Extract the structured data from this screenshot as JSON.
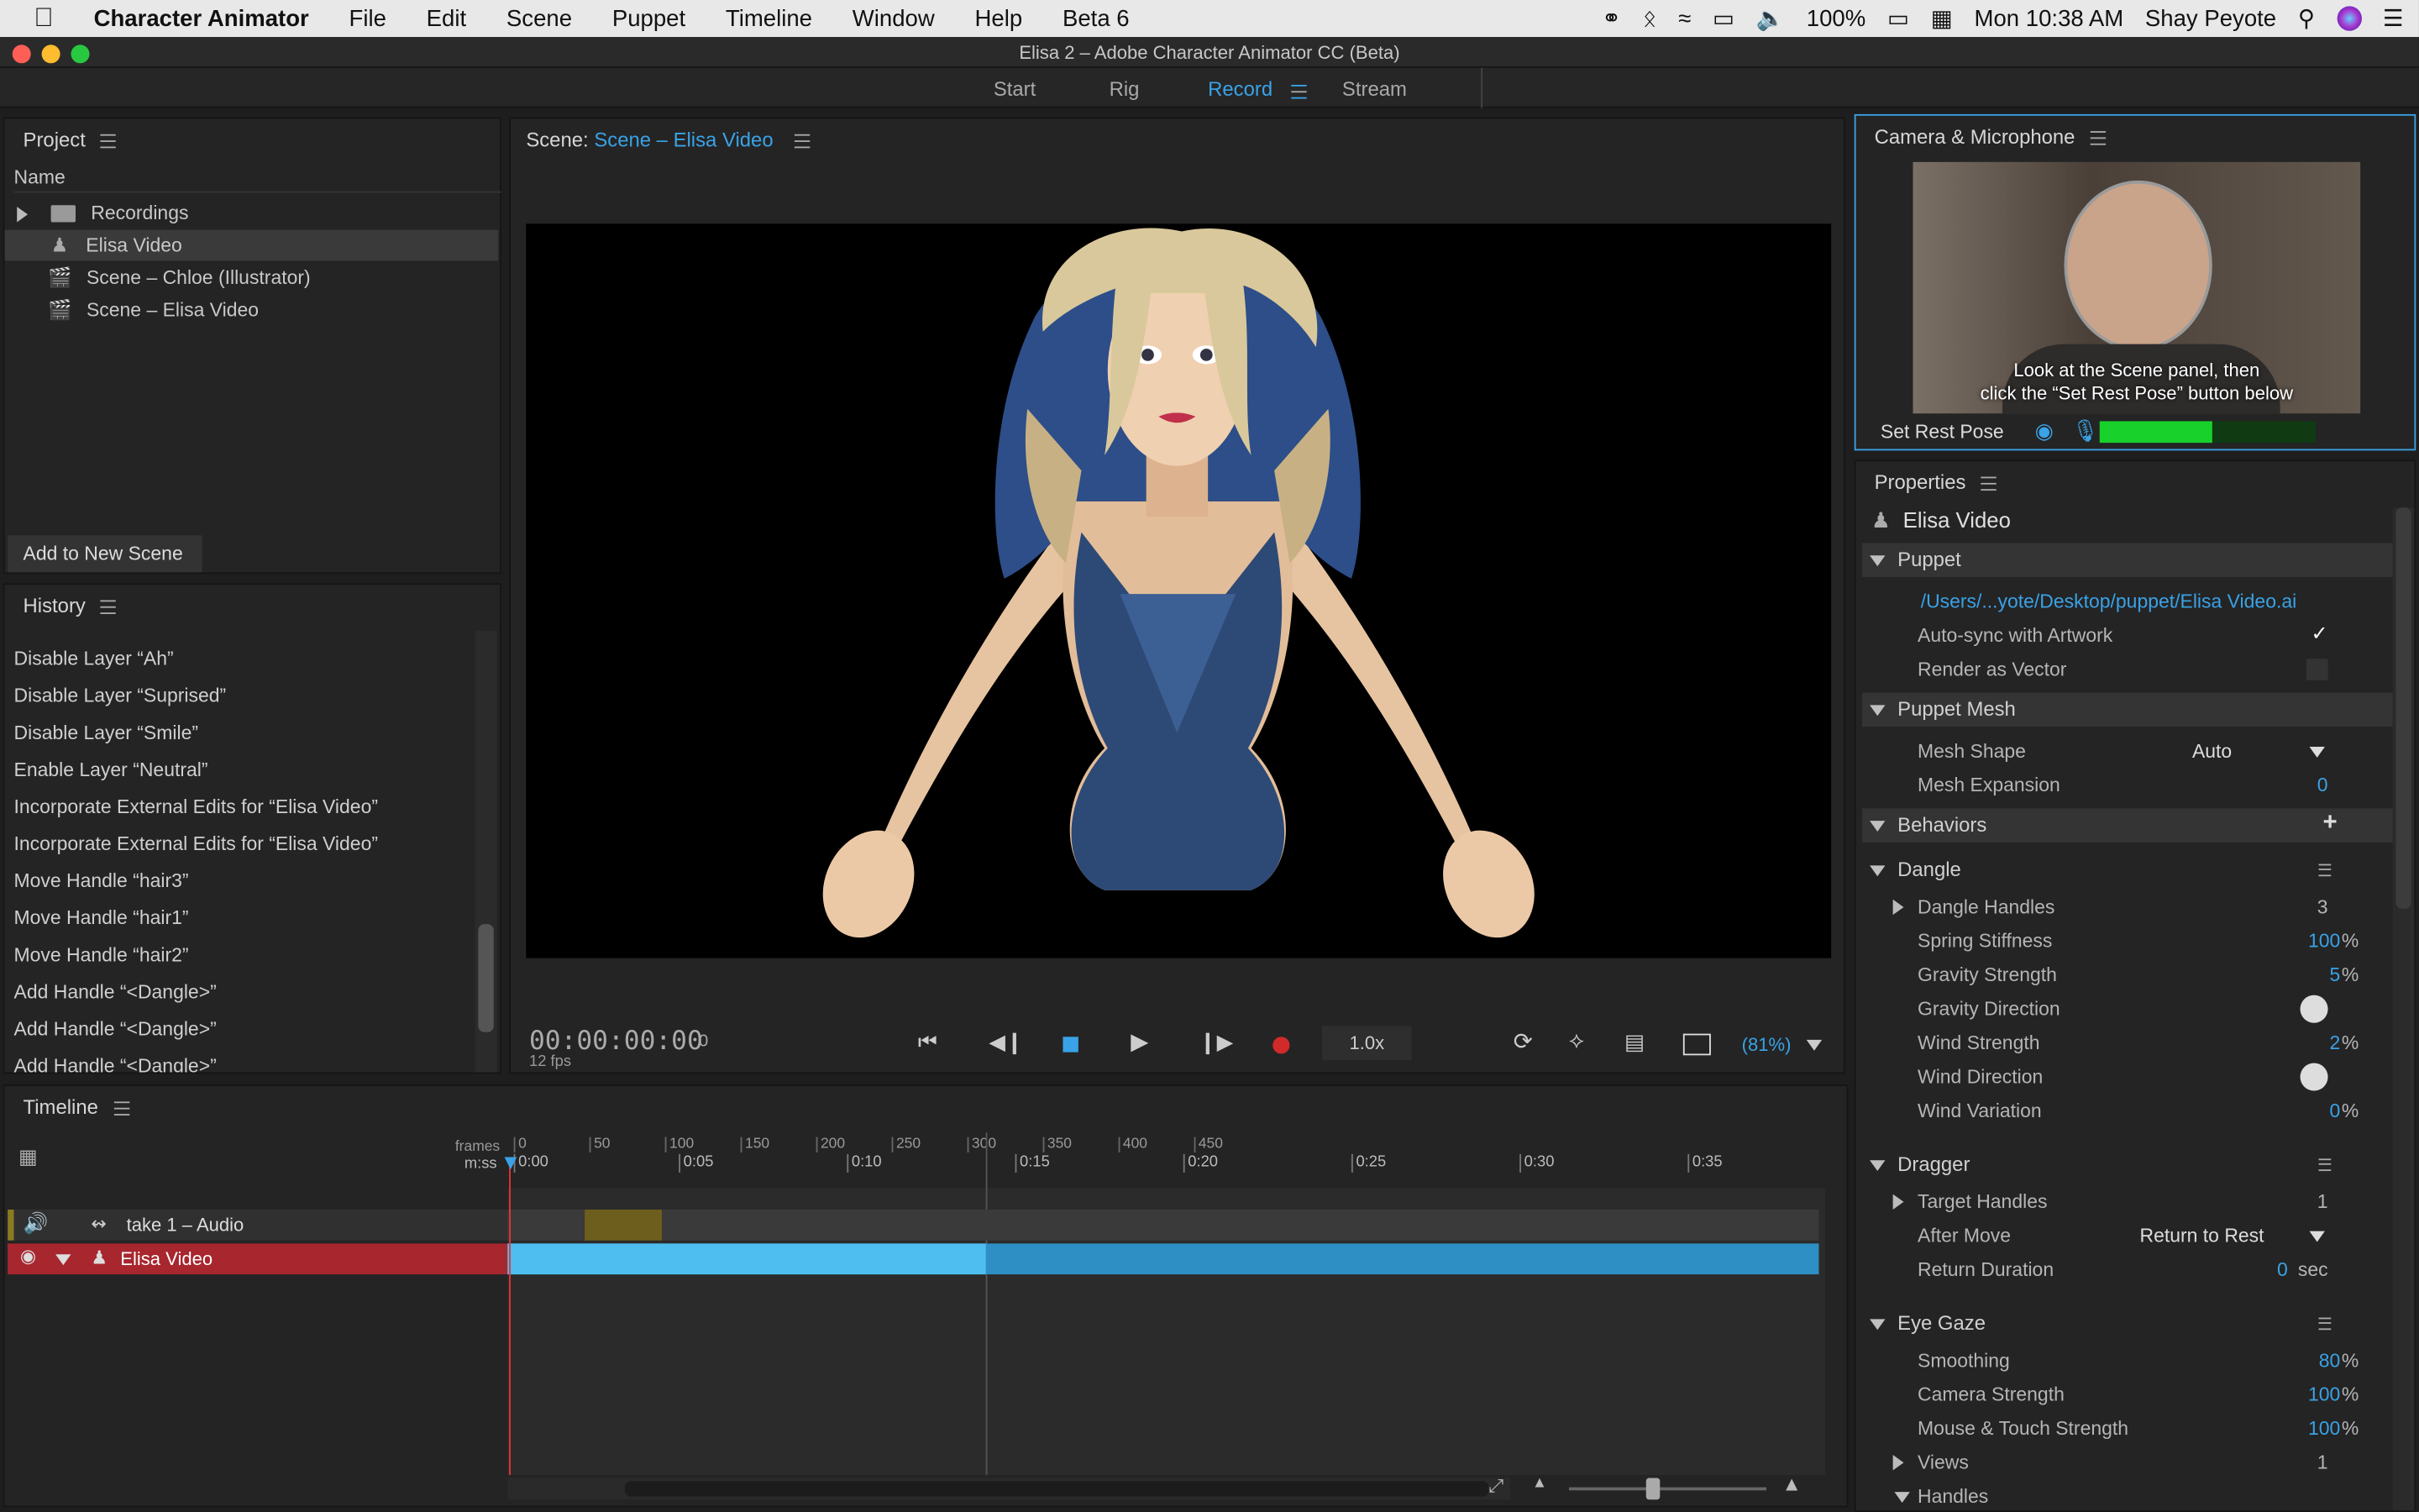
{
  "menubar": {
    "app": "Character Animator",
    "items": [
      "File",
      "Edit",
      "Scene",
      "Puppet",
      "Timeline",
      "Window",
      "Help",
      "Beta 6"
    ],
    "battery": "100%",
    "clock": "Mon 10:38 AM",
    "user": "Shay Peyote"
  },
  "window": {
    "title": "Elisa 2 – Adobe Character Animator CC (Beta)"
  },
  "workspace": {
    "tabs": [
      "Start",
      "Rig",
      "Record",
      "Stream"
    ],
    "active": "Record"
  },
  "project": {
    "title": "Project",
    "column": "Name",
    "items": [
      "Recordings",
      "Elisa Video",
      "Scene – Chloe (Illustrator)",
      "Scene – Elisa Video"
    ],
    "add_button": "Add to New Scene"
  },
  "history": {
    "title": "History",
    "items": [
      "Disable Layer “Ah”",
      "Disable Layer “Suprised”",
      "Disable Layer “Smile”",
      "Enable Layer “Neutral”",
      "Incorporate External Edits for “Elisa Video”",
      "Incorporate External Edits for “Elisa Video”",
      "Move Handle “hair3”",
      "Move Handle “hair1”",
      "Move Handle “hair2”",
      "Add Handle “<Dangle>”",
      "Add Handle “<Dangle>”",
      "Add Handle “<Dangle>”"
    ]
  },
  "scene": {
    "label": "Scene:",
    "name": "Scene – Elisa Video",
    "timecode": "00:00:00:00",
    "frame": "0",
    "fps": "12 fps",
    "speed": "1.0x",
    "zoom": "(81%)"
  },
  "camera": {
    "title": "Camera & Microphone",
    "hint_line1": "Look at the Scene panel, then",
    "hint_line2": "click the “Set Rest Pose” button below",
    "set_rest": "Set Rest Pose",
    "audio_level": 0.52
  },
  "properties": {
    "title": "Properties",
    "puppet_name": "Elisa Video",
    "puppet": {
      "header": "Puppet",
      "path": "/Users/...yote/Desktop/puppet/Elisa Video.ai",
      "auto_sync": "Auto-sync with Artwork",
      "render_vector": "Render as Vector",
      "auto_sync_check": "✓"
    },
    "mesh": {
      "header": "Puppet Mesh",
      "shape_label": "Mesh Shape",
      "shape_value": "Auto",
      "expansion_label": "Mesh Expansion",
      "expansion_value": "0"
    },
    "behaviors": {
      "header": "Behaviors",
      "add": "+"
    },
    "dangle": {
      "header": "Dangle",
      "handles_label": "Dangle Handles",
      "handles_value": "3",
      "spring_label": "Spring Stiffness",
      "spring_value": "100",
      "gravity_label": "Gravity Strength",
      "gravity_value": "5",
      "gdir_label": "Gravity Direction",
      "wind_label": "Wind Strength",
      "wind_value": "2",
      "wdir_label": "Wind Direction",
      "wvar_label": "Wind Variation",
      "wvar_value": "0",
      "pct": "%"
    },
    "dragger": {
      "header": "Dragger",
      "target_label": "Target Handles",
      "target_value": "1",
      "after_label": "After Move",
      "after_value": "Return to Rest",
      "dur_label": "Return Duration",
      "dur_value": "0",
      "dur_unit": "sec"
    },
    "eye": {
      "header": "Eye Gaze",
      "smooth_label": "Smoothing",
      "smooth_value": "80",
      "cam_label": "Camera Strength",
      "cam_value": "100",
      "mouse_label": "Mouse & Touch Strength",
      "mouse_value": "100",
      "views_label": "Views",
      "views_value": "1",
      "handles_label": "Handles"
    }
  },
  "timeline": {
    "title": "Timeline",
    "frames_label": "frames",
    "mss_label": "m:ss",
    "frame_ticks": [
      "0",
      "50",
      "100",
      "150",
      "200",
      "250",
      "300",
      "350",
      "400",
      "450"
    ],
    "time_ticks": [
      "0:00",
      "0:05",
      "0:10",
      "0:15",
      "0:20",
      "0:25",
      "0:30",
      "0:35"
    ],
    "tracks": [
      "take 1 – Audio",
      "Elisa Video"
    ]
  }
}
